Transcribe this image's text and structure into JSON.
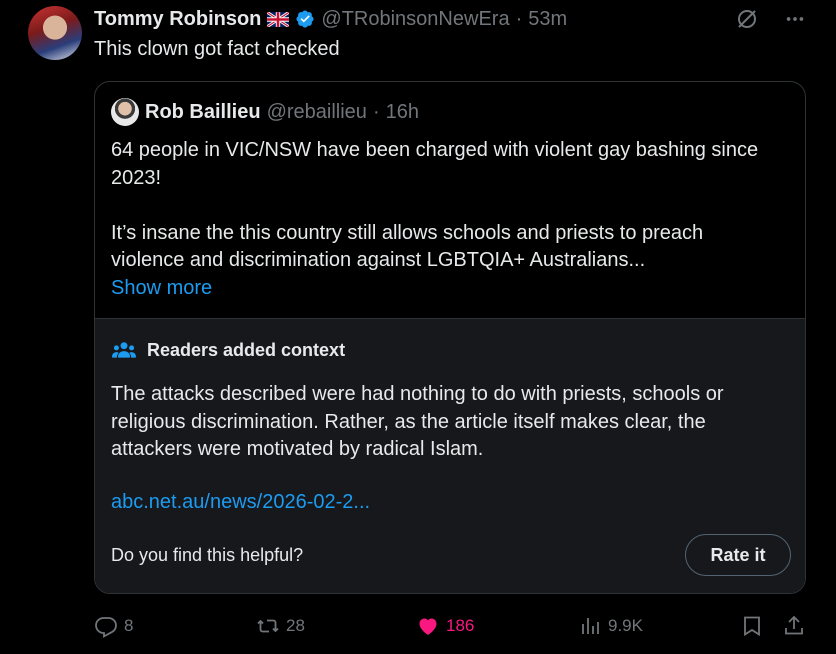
{
  "post": {
    "author_name": "Tommy Robinson",
    "handle": "@TRobinsonNewEra",
    "separator": "·",
    "time": "53m",
    "text": "This clown got fact checked"
  },
  "quote": {
    "author_name": "Rob Baillieu",
    "handle": "@rebaillieu",
    "separator": "·",
    "time": "16h",
    "text_line1": "64 people in VIC/NSW have been charged with violent gay bashing since 2023!",
    "text_line2": "It’s insane the this country still allows schools and priests to preach violence and discrimination against LGBTQIA+ Australians...",
    "show_more": "Show more"
  },
  "context": {
    "title": "Readers added context",
    "text": "The attacks described were had nothing to do with priests, schools or religious discrimination. Rather, as the article itself makes clear, the attackers were motivated by radical Islam.",
    "link": "abc.net.au/news/2026-02-2...",
    "helpful_prompt": "Do you find this helpful?",
    "rate_label": "Rate it"
  },
  "actions": {
    "replies": "8",
    "reposts": "28",
    "likes": "186",
    "views": "9.9K"
  },
  "colors": {
    "background": "#000000",
    "accent": "#1d9bf0",
    "like": "#f91880",
    "muted": "#71767b",
    "context_bg": "#16181c"
  },
  "icons": [
    "uk-flag-icon",
    "verified-badge-icon",
    "grok-icon",
    "more-icon",
    "readers-icon",
    "reply-icon",
    "repost-icon",
    "like-icon",
    "views-icon",
    "bookmark-icon",
    "share-icon"
  ]
}
